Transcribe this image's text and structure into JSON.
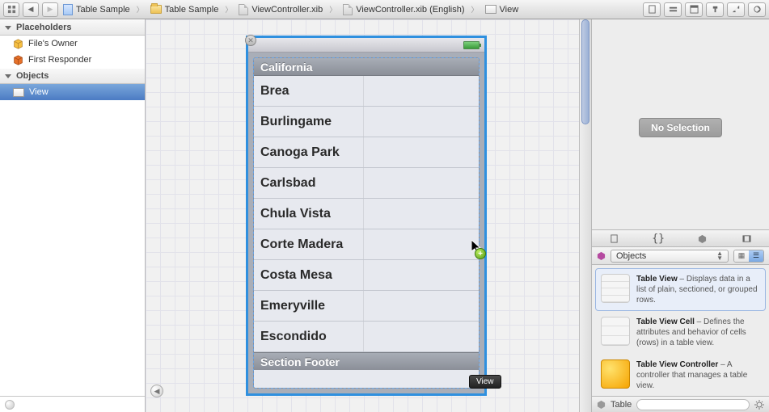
{
  "toolbar": {
    "back_glyph": "◀",
    "fwd_glyph": "▶",
    "crumbs": [
      {
        "label": "Table Sample",
        "icon": "blue-doc"
      },
      {
        "label": "Table Sample",
        "icon": "folder"
      },
      {
        "label": "ViewController.xib",
        "icon": "gray-doc"
      },
      {
        "label": "ViewController.xib (English)",
        "icon": "gray-doc"
      },
      {
        "label": "View",
        "icon": "view"
      }
    ]
  },
  "outline": {
    "placeholders_header": "Placeholders",
    "objects_header": "Objects",
    "placeholders": [
      {
        "label": "File's Owner"
      },
      {
        "label": "First Responder"
      }
    ],
    "objects": [
      {
        "label": "View",
        "selected": true
      }
    ]
  },
  "device": {
    "section_header": "California",
    "section_footer": "Section Footer",
    "rows": [
      "Brea",
      "Burlingame",
      "Canoga Park",
      "Carlsbad",
      "Chula Vista",
      "Corte Madera",
      "Costa Mesa",
      "Emeryville",
      "Escondido"
    ],
    "size_tag": "View"
  },
  "inspector": {
    "no_selection": "No Selection"
  },
  "library": {
    "popup_label": "Objects",
    "search_label": "Table",
    "items": [
      {
        "title": "Table View",
        "desc": " – Displays data in a list of plain, sectioned, or grouped rows.",
        "selected": true,
        "thumb": "lines"
      },
      {
        "title": "Table View Cell",
        "desc": " – Defines the attributes and behavior of cells (rows) in a table view.",
        "selected": false,
        "thumb": "lines"
      },
      {
        "title": "Table View Controller",
        "desc": " – A controller that manages a table view.",
        "selected": false,
        "thumb": "yellow"
      }
    ]
  }
}
